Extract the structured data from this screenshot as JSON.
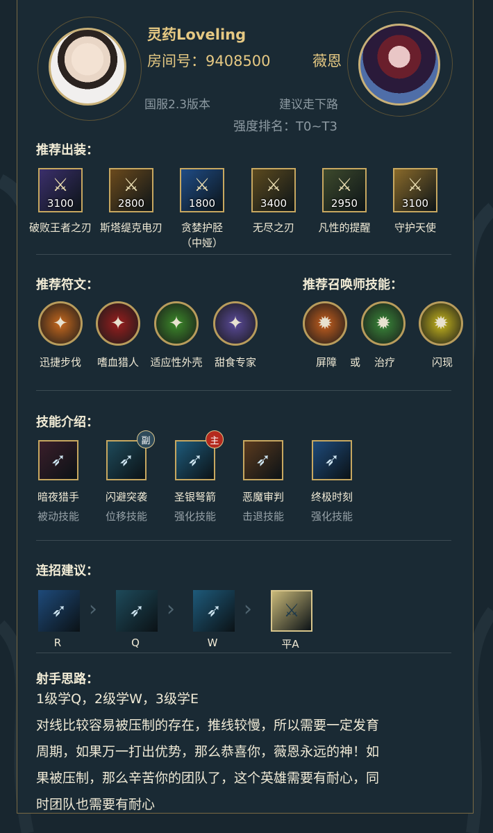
{
  "header": {
    "player_name": "灵药Loveling",
    "room_label": "房间号：9408500",
    "hero_name": "薇恩",
    "version": "国服2.3版本",
    "lane": "建议走下路",
    "tier": "强度排名：T0~T3"
  },
  "items_section": {
    "heading": "推荐出装：",
    "items": [
      {
        "price": "3100",
        "name": "破败王者之刃",
        "icon": "ruined-king-icon",
        "color": "#3b2f6b"
      },
      {
        "price": "2800",
        "name": "斯塔缇克电刃",
        "icon": "statikk-shiv-icon",
        "color": "#6b4a1c"
      },
      {
        "price": "1800",
        "name": "贪婪护胫",
        "name2": "（中娅）",
        "icon": "boots-icon",
        "color": "#1f4c86"
      },
      {
        "price": "3400",
        "name": "无尽之刃",
        "icon": "infinity-edge-icon",
        "color": "#5c4a1e"
      },
      {
        "price": "2950",
        "name": "凡性的提醒",
        "icon": "mortal-reminder-icon",
        "color": "#3e4a2c"
      },
      {
        "price": "3100",
        "name": "守护天使",
        "icon": "guardian-angel-icon",
        "color": "#8a6a2a"
      }
    ]
  },
  "runes_section": {
    "heading": "推荐符文：",
    "runes": [
      {
        "name": "迅捷步伐",
        "icon": "fleet-footwork-icon",
        "color": "#c96a1e"
      },
      {
        "name": "嗜血猎人",
        "icon": "ravenous-hunter-icon",
        "color": "#9a1e1e"
      },
      {
        "name": "适应性外壳",
        "icon": "adaptive-shell-icon",
        "color": "#3c8a2a"
      },
      {
        "name": "甜食专家",
        "icon": "sweet-tooth-icon",
        "color": "#5a4a9a"
      }
    ]
  },
  "spells_section": {
    "heading": "推荐召唤师技能：",
    "spells": [
      {
        "name": "屏障",
        "icon": "barrier-icon",
        "color": "#c8601e"
      },
      {
        "name": "治疗",
        "icon": "heal-icon",
        "color": "#3a8a3a"
      },
      {
        "name": "闪现",
        "icon": "flash-icon",
        "color": "#c8b81e"
      }
    ],
    "or_label": "或"
  },
  "skills_section": {
    "heading": "技能介绍：",
    "skills": [
      {
        "name": "暗夜猎手",
        "type": "被动技能",
        "icon": "night-hunter-icon",
        "color": "#3a1e2a"
      },
      {
        "name": "闪避突袭",
        "type": "位移技能",
        "icon": "tumble-icon",
        "color": "#1e4a5a",
        "badge": "副"
      },
      {
        "name": "圣银弩箭",
        "type": "强化技能",
        "icon": "silver-bolts-icon",
        "color": "#1e5a7a",
        "badge": "主"
      },
      {
        "name": "恶魔审判",
        "type": "击退技能",
        "icon": "condemn-icon",
        "color": "#5a3a1e"
      },
      {
        "name": "终极时刻",
        "type": "强化技能",
        "icon": "final-hour-icon",
        "color": "#1e4a7a"
      }
    ]
  },
  "combo_section": {
    "heading": "连招建议：",
    "steps": [
      {
        "label": "R",
        "icon": "final-hour-icon",
        "color": "#1e4a7a"
      },
      {
        "label": "Q",
        "icon": "tumble-icon",
        "color": "#1e4a5a"
      },
      {
        "label": "W",
        "icon": "silver-bolts-icon",
        "color": "#1e5a7a"
      },
      {
        "label": "平A",
        "icon": "basic-attack-icon",
        "color": "#c8b878"
      }
    ]
  },
  "tips_section": {
    "heading": "射手思路：",
    "line1": "1级学Q，2级学W，3级学E",
    "para": [
      "对线比较容易被压制的存在，推线较慢，所以需要一定发育",
      "周期，如果万一打出优势，那么恭喜你，薇恩永远的神！如",
      "果被压制，那么辛苦你的团队了，这个英雄需要有耐心，同",
      "时团队也需要有耐心"
    ]
  }
}
